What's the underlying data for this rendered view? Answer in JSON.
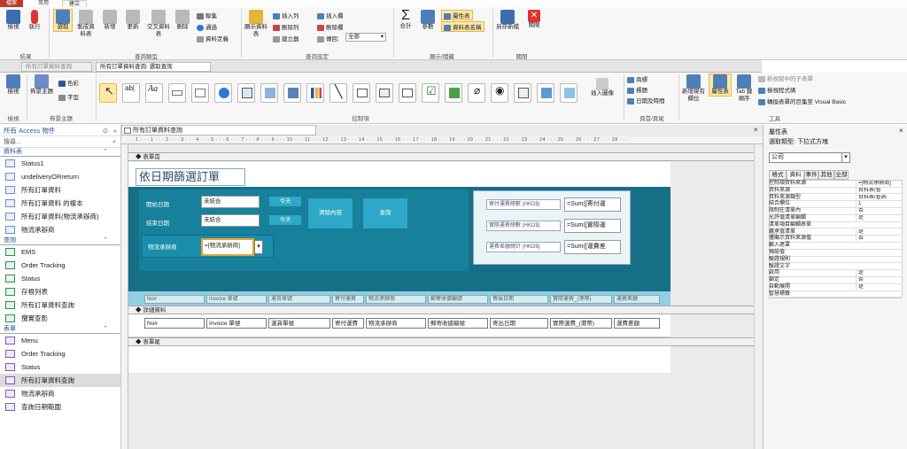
{
  "top_tabs": [
    "檔案",
    "常用",
    "建立"
  ],
  "ribbon1": {
    "results_group": {
      "label": "結果",
      "buttons": [
        "檢視",
        "執行"
      ]
    },
    "query_type_group": {
      "label": "查詢類型",
      "buttons": [
        "選取",
        "製成資料表",
        "新增",
        "更新",
        "交叉資料表",
        "刪除"
      ],
      "small": [
        "聯集",
        "通過",
        "資料定義"
      ]
    },
    "query_setup_group": {
      "label": "查詢設定",
      "buttons": [
        "顯示資料表"
      ],
      "small": [
        "插入列",
        "刪除列",
        "建立器",
        "插入欄",
        "刪除欄"
      ],
      "return_label": "傳回:",
      "return_value": "全部"
    },
    "show_hide_group": {
      "label": "顯示/隱藏",
      "buttons": [
        "合計",
        "參數"
      ],
      "small": [
        "屬性表",
        "資料表名稱"
      ]
    },
    "close_group": {
      "label": "關閉",
      "buttons": [
        "另存新檔",
        "關閉"
      ]
    }
  },
  "doc_tabs": [
    "所有訂單資料查詢",
    "所有訂單資料查詢: 選取查詢"
  ],
  "ribbon2": {
    "views": {
      "label": "檢視",
      "button": "檢視"
    },
    "themes": {
      "label": "佈景主題",
      "button": "佈景主題",
      "colors": "色彩",
      "fonts": "字型"
    },
    "controls": {
      "label": "控制項",
      "insert_image": "插入圖像"
    },
    "header_footer": {
      "label": "頁首/頁尾",
      "items": [
        "商標",
        "標題",
        "日期及時間"
      ]
    },
    "tools": {
      "label": "工具",
      "buttons": [
        "新增現有欄位",
        "屬性表",
        "Tab 鍵順序"
      ],
      "small": [
        "新視窗中的子表單",
        "檢視程式碼",
        "轉換表單的巨集至 Visual Basic"
      ]
    }
  },
  "nav": {
    "title": "所有 Access 物件",
    "search_placeholder": "搜尋...",
    "sections": [
      {
        "name": "資料表",
        "kind": "t",
        "items": [
          "Status1",
          "undeliveryORreturn",
          "所有訂單資料",
          "所有訂單資料 的複本",
          "所有訂單資料(物流承辦商)",
          "物流承辦商"
        ]
      },
      {
        "name": "查詢",
        "kind": "q",
        "items": [
          "EMS",
          "Order Tracking",
          "Status",
          "存根列表",
          "所有訂單資料查詢",
          "攬實查影"
        ]
      },
      {
        "name": "表單",
        "kind": "f",
        "items": [
          "Menu",
          "Order Tracking",
          "Status",
          "所有訂單資料查詢",
          "物流承辦商",
          "查詢日期範圍"
        ]
      }
    ],
    "selected": "所有訂單資料查詢"
  },
  "design": {
    "tab_title": "所有訂單資料查詢",
    "ruler": "· 1 · · · 1 · · · 2 · · · 3 · · · 4 · · · 5 · · · 6 · · · 7 · · · 8 · · · 9 · · · 10 · · · 11 · · · 12 · · · 13 · · · 14 · · · 15 · · · 16 · · · 17 · · · 18 · · · 19 · · · 20 · · · 21 · · · 22 · · · 23 · · · 24 · · · 25 · · · 26 · · · 27 · · · 28 · · ·",
    "header_section": "表單首",
    "detail_section": "詳細資料",
    "footer_section": "表單尾",
    "form_title": "依日期篩選訂單",
    "start_label": "開始日期",
    "start_value": "未結合",
    "end_label": "結束日期",
    "end_value": "未結合",
    "today1": "今天",
    "today2": "今天",
    "clear_btn": "清除內容",
    "query_btn": "查詢",
    "logistics_label": "物流承辦商",
    "logistics_value": "=[物流承辦商]",
    "sum_labels": [
      "寄付運費總數 (HKD$)",
      "實際運費總數 (HKD$)",
      "運費差額總計 (HKD$)"
    ],
    "sum_values": [
      "=Sum([寄付運",
      "=Sum([實際運",
      "=Sum([運費差"
    ],
    "columns": [
      "No#",
      "Invoice 單號",
      "運貨單號",
      "寄付運費",
      "物流承辦商",
      "郵寄收據編號",
      "寄出日期",
      "實際運費_(港幣)",
      "運費差額"
    ]
  },
  "props": {
    "title": "屬性表",
    "sel_type_label": "選取類型:",
    "sel_type": "下拉式方塊",
    "object": "公司",
    "tabs": [
      "格式",
      "資料",
      "事件",
      "其他",
      "全部"
    ],
    "rows": [
      [
        "控制項資料來源",
        "=[物流承辦商]"
      ],
      [
        "資料來源",
        "資料表/查"
      ],
      [
        "資料來源類型",
        "資料表/查詢"
      ],
      [
        "結合欄位",
        "1"
      ],
      [
        "限制在清單內",
        "否"
      ],
      [
        "允許值清單編輯",
        "是"
      ],
      [
        "清單項目編輯表單",
        ""
      ],
      [
        "繼承值清單",
        "是"
      ],
      [
        "僅顯示資料來源值",
        "否"
      ],
      [
        "輸入遮罩",
        ""
      ],
      [
        "預設值",
        ""
      ],
      [
        "驗證規則",
        ""
      ],
      [
        "驗證文字",
        ""
      ],
      [
        "啟用",
        "是"
      ],
      [
        "鎖定",
        "否"
      ],
      [
        "自動展開",
        "是"
      ],
      [
        "智慧標籤",
        ""
      ]
    ]
  }
}
